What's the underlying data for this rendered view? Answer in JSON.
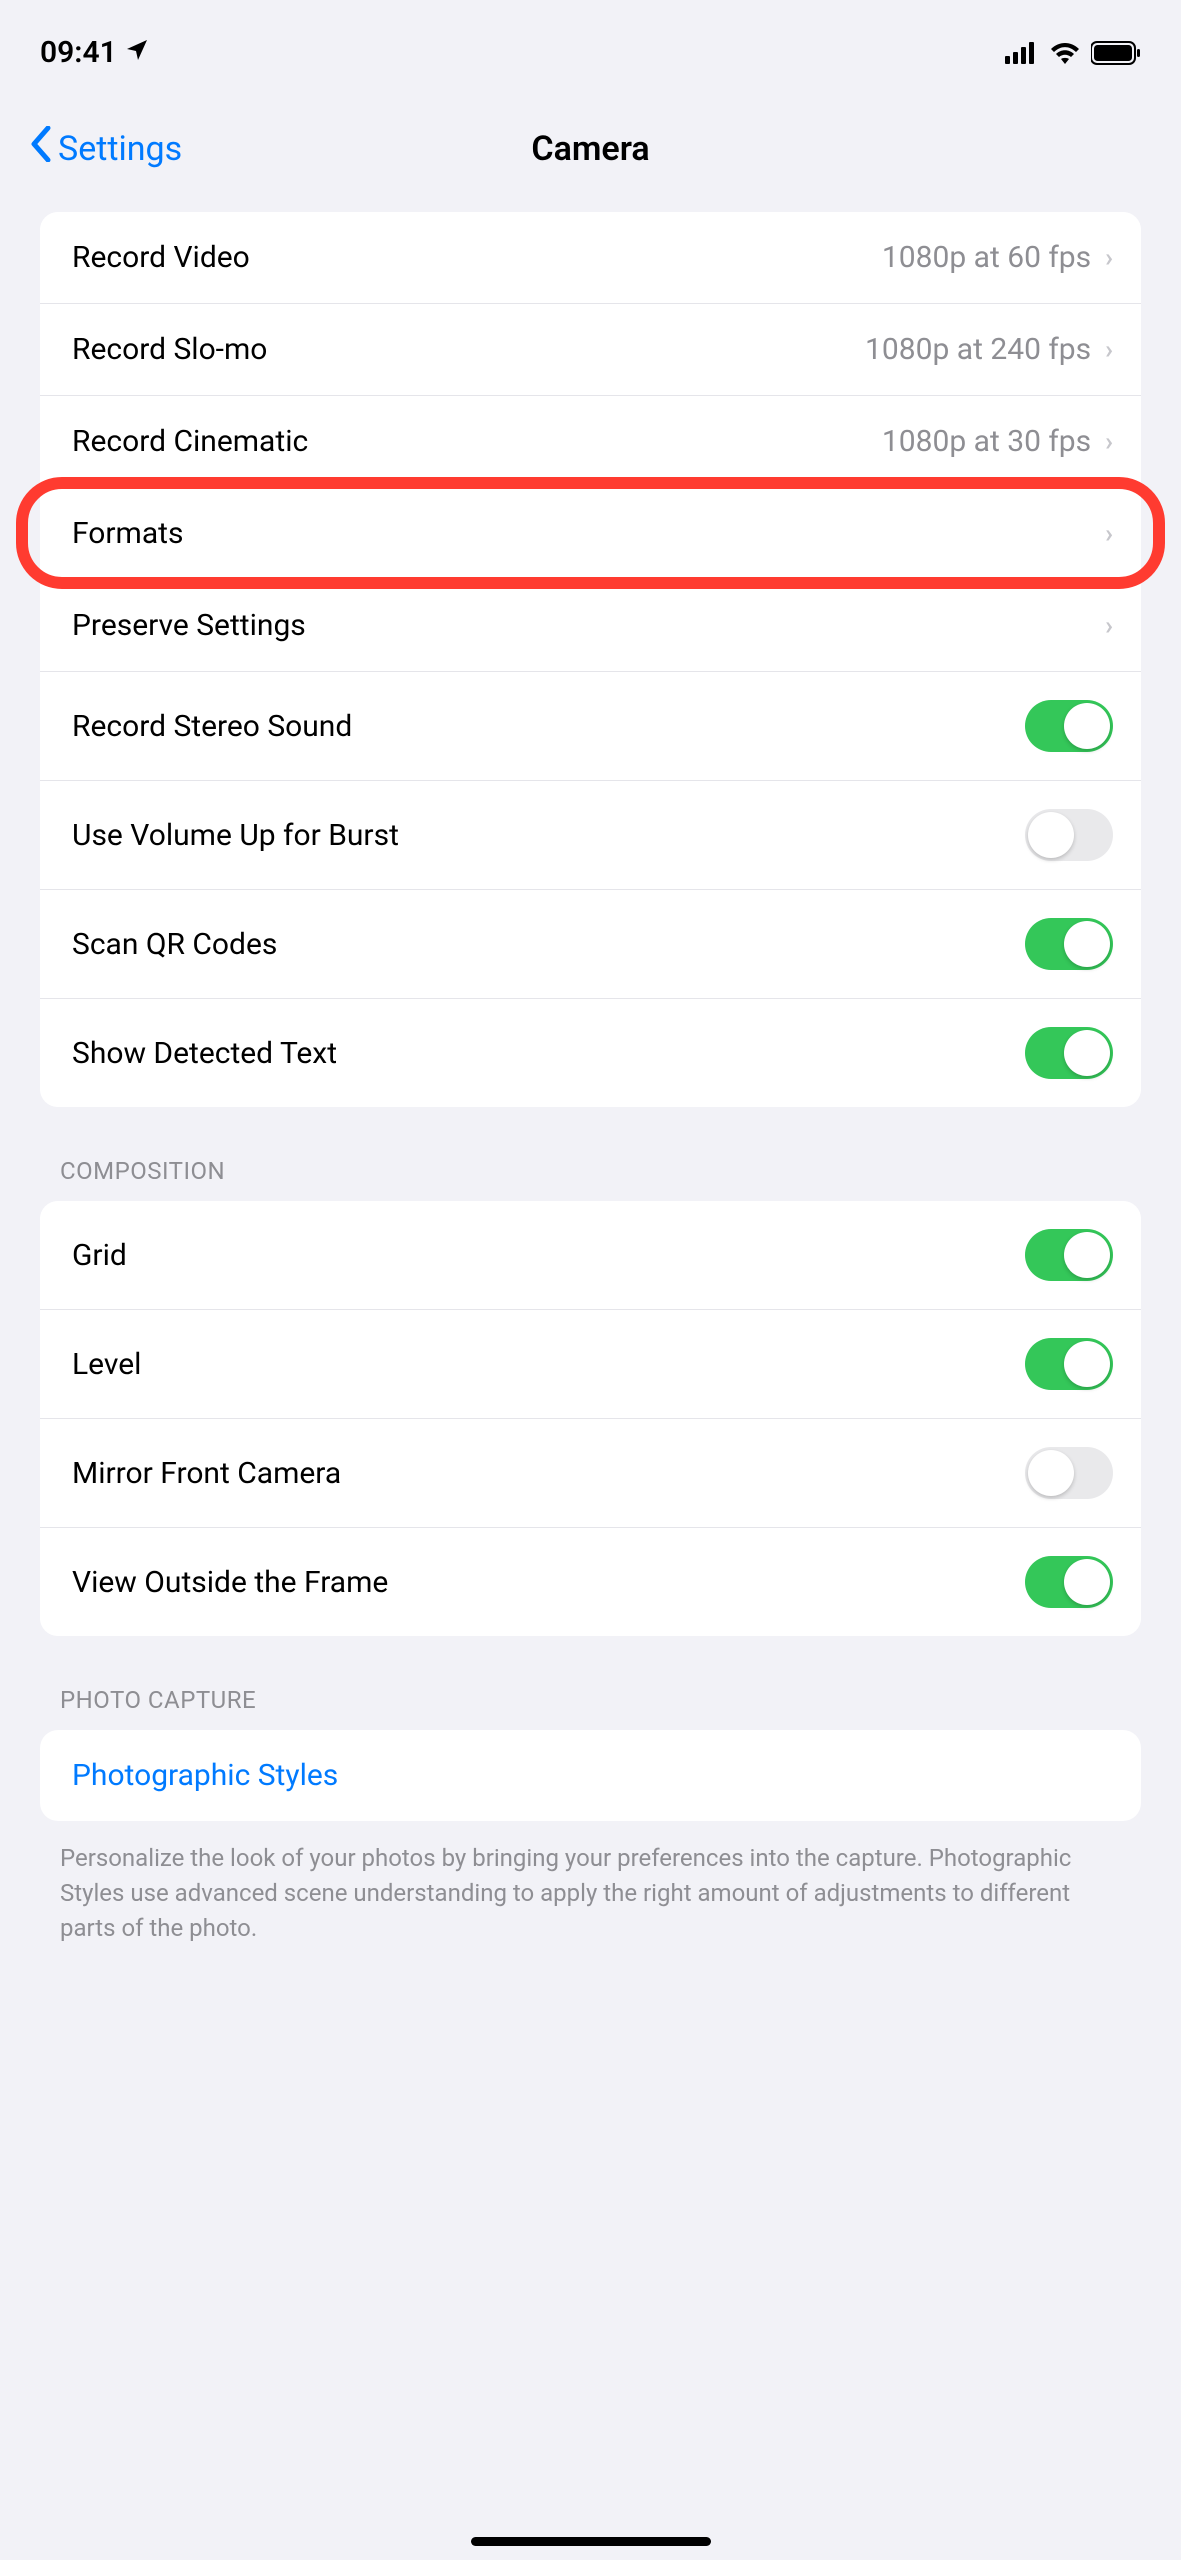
{
  "status": {
    "time": "09:41"
  },
  "nav": {
    "back": "Settings",
    "title": "Camera"
  },
  "groups": {
    "recording": {
      "items": [
        {
          "label": "Record Video",
          "value": "1080p at 60 fps",
          "type": "nav"
        },
        {
          "label": "Record Slo-mo",
          "value": "1080p at 240 fps",
          "type": "nav"
        },
        {
          "label": "Record Cinematic",
          "value": "1080p at 30 fps",
          "type": "nav"
        },
        {
          "label": "Formats",
          "value": "",
          "type": "nav"
        },
        {
          "label": "Preserve Settings",
          "value": "",
          "type": "nav"
        },
        {
          "label": "Record Stereo Sound",
          "on": true,
          "type": "toggle"
        },
        {
          "label": "Use Volume Up for Burst",
          "on": false,
          "type": "toggle"
        },
        {
          "label": "Scan QR Codes",
          "on": true,
          "type": "toggle"
        },
        {
          "label": "Show Detected Text",
          "on": true,
          "type": "toggle"
        }
      ]
    },
    "composition": {
      "header": "Composition",
      "items": [
        {
          "label": "Grid",
          "on": true,
          "type": "toggle"
        },
        {
          "label": "Level",
          "on": true,
          "type": "toggle"
        },
        {
          "label": "Mirror Front Camera",
          "on": false,
          "type": "toggle"
        },
        {
          "label": "View Outside the Frame",
          "on": true,
          "type": "toggle"
        }
      ]
    },
    "photoCapture": {
      "header": "Photo Capture",
      "items": [
        {
          "label": "Photographic Styles",
          "type": "link"
        }
      ],
      "footer": "Personalize the look of your photos by bringing your preferences into the capture. Photographic Styles use advanced scene understanding to apply the right amount of adjustments to different parts of the photo."
    }
  },
  "highlight": {
    "row": "Formats"
  }
}
